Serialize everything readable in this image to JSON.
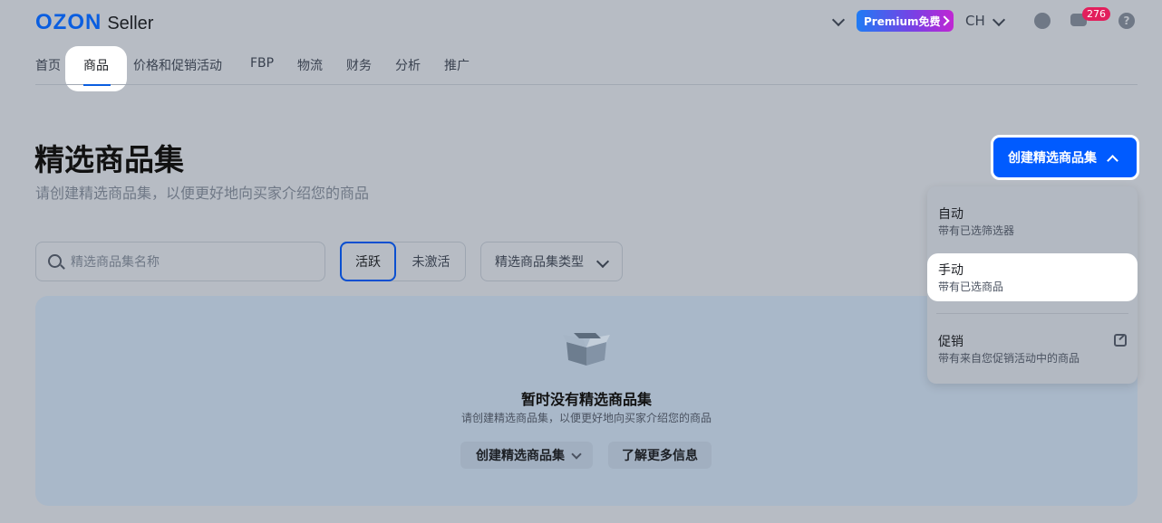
{
  "header": {
    "logo": "OZON",
    "logo_sub": "Seller",
    "premium_label": "Premium免费",
    "language": "CH",
    "notifications_count": "276"
  },
  "nav": {
    "items": [
      "首页",
      "商品",
      "价格和促销活动",
      "FBP",
      "物流",
      "财务",
      "分析",
      "推广"
    ],
    "active": "商品"
  },
  "page": {
    "title": "精选商品集",
    "subtitle": "请创建精选商品集，以便更好地向买家介绍您的商品",
    "create_button": "创建精选商品集"
  },
  "filters": {
    "search_placeholder": "精选商品集名称",
    "segment_active": "活跃",
    "segment_inactive": "未激活",
    "type_select": "精选商品集类型"
  },
  "empty": {
    "title": "暂时没有精选商品集",
    "subtitle": "请创建精选商品集，以便更好地向买家介绍您的商品",
    "create_button": "创建精选商品集",
    "learn_button": "了解更多信息"
  },
  "dropdown": {
    "items": [
      {
        "title": "自动",
        "subtitle": "带有已选筛选器"
      },
      {
        "title": "手动",
        "subtitle": "带有已选商品"
      },
      {
        "title": "促销",
        "subtitle": "带有来自您促销活动中的商品"
      }
    ]
  },
  "colors": {
    "brand": "#005bff",
    "badge": "#e21f5c"
  }
}
